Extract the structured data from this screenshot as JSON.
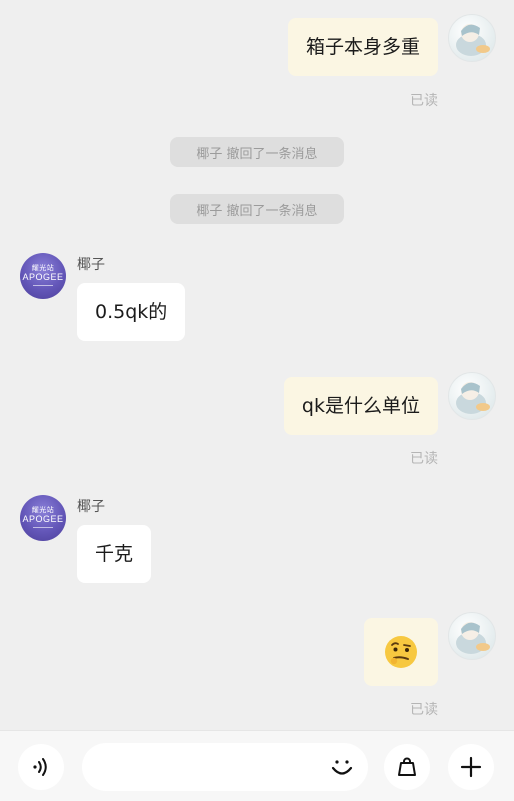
{
  "messages": [
    {
      "side": "self",
      "text": "箱子本身多重",
      "status": "已读"
    },
    {
      "type": "system",
      "text": "椰子 撤回了一条消息"
    },
    {
      "type": "system",
      "text": "椰子 撤回了一条消息"
    },
    {
      "side": "other",
      "sender": "椰子",
      "text": "0.5qk的"
    },
    {
      "side": "self",
      "text": "qk是什么单位",
      "status": "已读"
    },
    {
      "side": "other",
      "sender": "椰子",
      "text": "千克"
    },
    {
      "side": "self",
      "emoji": "thinking-face",
      "status": "已读"
    }
  ],
  "contact": {
    "avatar_top": "耀光站",
    "avatar_main": "APOGEE"
  },
  "input": {
    "placeholder": ""
  },
  "icons": {
    "voice": "voice-wave-icon",
    "emoji": "smile-icon",
    "bag": "shopping-bag-icon",
    "plus": "plus-icon"
  },
  "colors": {
    "background": "#efefef",
    "self_bubble": "#fbf6e3",
    "other_bubble": "#ffffff",
    "system_pill": "#dedede",
    "read_text": "#b5b5b5"
  }
}
